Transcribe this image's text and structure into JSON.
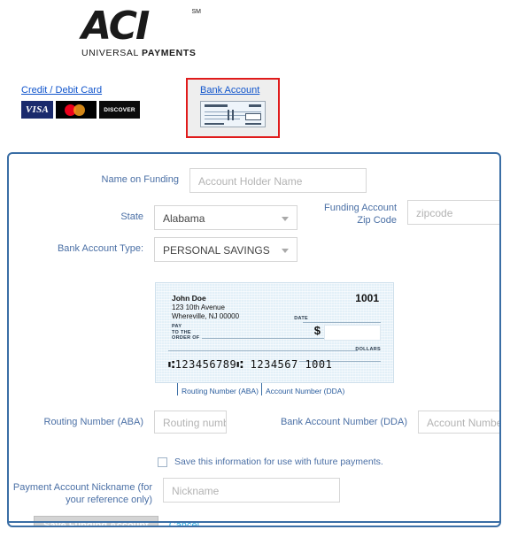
{
  "brand": {
    "mark": "ACI",
    "superscript": "SM",
    "tagline_light": "UNIVERSAL ",
    "tagline_bold": "PAYMENTS"
  },
  "tabs": [
    {
      "id": "credit-debit-card",
      "label": "Credit / Debit Card",
      "selected": false,
      "card_logos": [
        "VISA",
        "mastercard",
        "DISCOVER"
      ]
    },
    {
      "id": "bank-account",
      "label": "Bank Account",
      "selected": true,
      "icon": "check-thumbnail-icon",
      "selected_border_color": "#e01b1b"
    }
  ],
  "form": {
    "name_on_funding": {
      "label": "Name on Funding",
      "placeholder": "Account Holder Name",
      "value": ""
    },
    "state": {
      "label": "State",
      "value": "Alabama"
    },
    "zip": {
      "label_line1": "Funding Account",
      "label_line2": "Zip Code",
      "placeholder": "zipcode",
      "value": ""
    },
    "bank_account_type": {
      "label": "Bank Account Type:",
      "value": "PERSONAL SAVINGS"
    },
    "routing": {
      "label": "Routing Number (ABA)",
      "placeholder": "Routing number",
      "value": ""
    },
    "account": {
      "label": "Bank Account Number (DDA)",
      "placeholder": "Account Number",
      "value": ""
    },
    "save_info": {
      "label": "Save this information for use with future payments.",
      "checked": false
    },
    "nickname": {
      "label_line1": "Payment Account Nickname (for",
      "label_line2": "your reference only)",
      "placeholder": "Nickname",
      "value": ""
    }
  },
  "check_sample": {
    "payer_name": "John Doe",
    "address_line1": "123 10th Avenue",
    "address_line2": "Whereville, NJ 00000",
    "check_number": "1001",
    "date_label": "DATE",
    "pay_line1": "PAY",
    "pay_line2": "TO THE",
    "pay_line3": "ORDER OF",
    "dollars_label": "DOLLARS",
    "currency_symbol": "$",
    "micr_line": "⑆123456789⑆  1234567  1001",
    "callout_routing": "Routing Number (ABA)",
    "callout_account": "Account Number (DDA)"
  },
  "actions": {
    "save_label": "Save Funding Account",
    "save_disabled": true,
    "cancel_label": "Cancel"
  },
  "colors": {
    "panel_border": "#3a6ea5",
    "label_blue": "#4a6fa5",
    "link_blue": "#1155cc",
    "cancel_blue": "#29abe2",
    "selected_tab_red": "#e01b1b",
    "check_bg": "#e3f0f8"
  }
}
